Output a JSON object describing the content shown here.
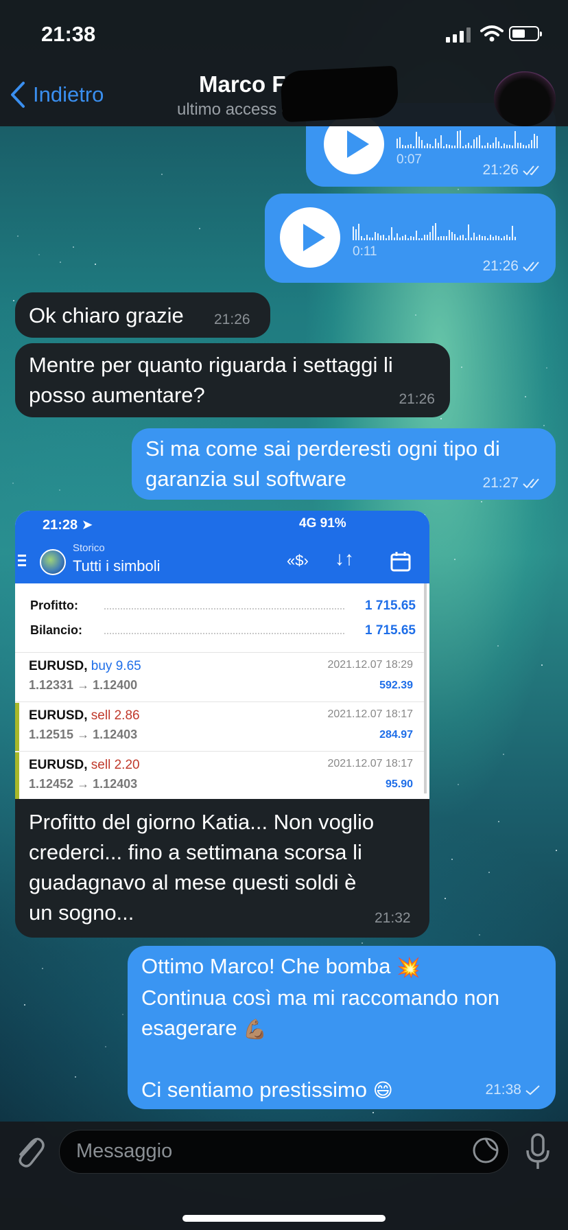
{
  "status_bar": {
    "time": "21:38"
  },
  "header": {
    "back_label": "Indietro",
    "chat_name": "Marco F",
    "chat_status": "ultimo access          ente"
  },
  "messages": [
    {
      "id": "voice1",
      "type": "voice",
      "direction": "out",
      "duration": "0:07",
      "time": "21:26",
      "read": true
    },
    {
      "id": "voice2",
      "type": "voice",
      "direction": "out",
      "duration": "0:11",
      "time": "21:26",
      "read": true
    },
    {
      "id": "m3",
      "type": "text",
      "direction": "in",
      "text": "Ok chiaro grazie",
      "time": "21:26"
    },
    {
      "id": "m4",
      "type": "text",
      "direction": "in",
      "lines": [
        "Mentre per quanto riguarda i settaggi li",
        "posso aumentare?"
      ],
      "time": "21:26"
    },
    {
      "id": "m5",
      "type": "text",
      "direction": "out",
      "lines": [
        "Si ma come sai perderesti ogni tipo di",
        "garanzia sul software"
      ],
      "time": "21:27",
      "read": true
    },
    {
      "id": "m6",
      "type": "image",
      "direction": "in",
      "caption_lines": [
        "Profitto del giorno Katia... Non voglio",
        "crederci... fino a settimana scorsa li",
        "guadagnavo al mese questi soldi è",
        "un sogno..."
      ],
      "time": "21:32"
    },
    {
      "id": "m7",
      "type": "text",
      "direction": "out",
      "lines": [
        "Ottimo Marco! Che bomba",
        "Continua così ma mi raccomando non",
        "esagerare",
        "",
        "Ci sentiamo prestissimo"
      ],
      "emojis": [
        "💥",
        "💪🏽",
        "😄"
      ],
      "time": "21:38",
      "read": true
    }
  ],
  "screenshot": {
    "time": "21:28",
    "status_right": "4G 91%",
    "subtitle": "Storico",
    "title": "Tutti i simboli",
    "summary": [
      {
        "label": "Profitto:",
        "value": "1 715.65"
      },
      {
        "label": "Bilancio:",
        "value": "1 715.65"
      }
    ],
    "deals": [
      {
        "symbol": "EURUSD,",
        "side": "buy",
        "volume": "9.65",
        "prices": "1.12331 → 1.12400",
        "datetime": "2021.12.07 18:29",
        "profit": "592.39"
      },
      {
        "symbol": "EURUSD,",
        "side": "sell",
        "volume": "2.86",
        "prices": "1.12515 → 1.12403",
        "datetime": "2021.12.07 18:17",
        "profit": "284.97"
      },
      {
        "symbol": "EURUSD,",
        "side": "sell",
        "volume": "2.20",
        "prices": "1.12452 → 1.12403",
        "datetime": "2021.12.07 18:17",
        "profit": "95.90"
      }
    ]
  },
  "input": {
    "placeholder": "Messaggio"
  },
  "colors": {
    "accent": "#3a95f2",
    "incoming": "#1c2226",
    "link": "#3a8ff0"
  },
  "icons": [
    "back-chevron-icon",
    "play-icon",
    "double-check-icon",
    "single-check-icon",
    "paperclip-icon",
    "sticker-icon",
    "microphone-icon"
  ]
}
